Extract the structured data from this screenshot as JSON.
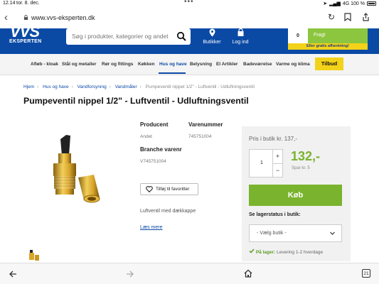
{
  "statusbar": {
    "time": "12.14",
    "date": "tor. 8. dec.",
    "network": "4G 100 %"
  },
  "browser": {
    "url": "www.vvs-eksperten.dk",
    "tabs_count": "21"
  },
  "header": {
    "logo_text": "VVS",
    "logo_sub": "EKSPERTEN",
    "search_placeholder": "Søg i produkter, kategorier og andet",
    "butikker": "Butikker",
    "login": "Log ind",
    "cart_count": "0",
    "cart_label": "Fragt",
    "promo": "Eller gratis afhentning!"
  },
  "nav": {
    "items": [
      "Afløb - kloak",
      "Stål og metaller",
      "Rør og fittings",
      "Køkken",
      "Hus og have",
      "Belysning",
      "El Artikler",
      "Badeværelse",
      "Varme og klima"
    ],
    "tilbud": "Tilbud"
  },
  "breadcrumb": [
    "Hjem",
    "Hus og have",
    "Vandforsyning",
    "Vandmåler",
    "Pumpeventil nippel 1/2\" - Luftventil - Udluftningsventil"
  ],
  "product": {
    "title": "Pumpeventil nippel 1/2\" - Luftventil - Udluftningsventil",
    "producent_label": "Producent",
    "producent": "Andet",
    "varenummer_label": "Varenummer",
    "varenummer": "745751004",
    "branche_label": "Branche varenr",
    "branche": "V745751004",
    "fav_label": "Tilføj til favoritter",
    "description": "Luftventil med dækkappe",
    "more": "Læs mere"
  },
  "buy": {
    "store_price": "Pris i butik kr. 137,-",
    "quantity": "1",
    "price": "132,-",
    "save": "Spar kr. 5",
    "buy_label": "Køb",
    "stock_heading": "Se lagerstatus i butik:",
    "store_select": "- Vælg butik -",
    "stock_status": "På lager:",
    "delivery": "Levering 1-2 hverdage"
  },
  "colors": {
    "brand_blue": "#0a4aa5",
    "accent_green": "#7ab32e",
    "promo_yellow": "#f3d21a"
  }
}
